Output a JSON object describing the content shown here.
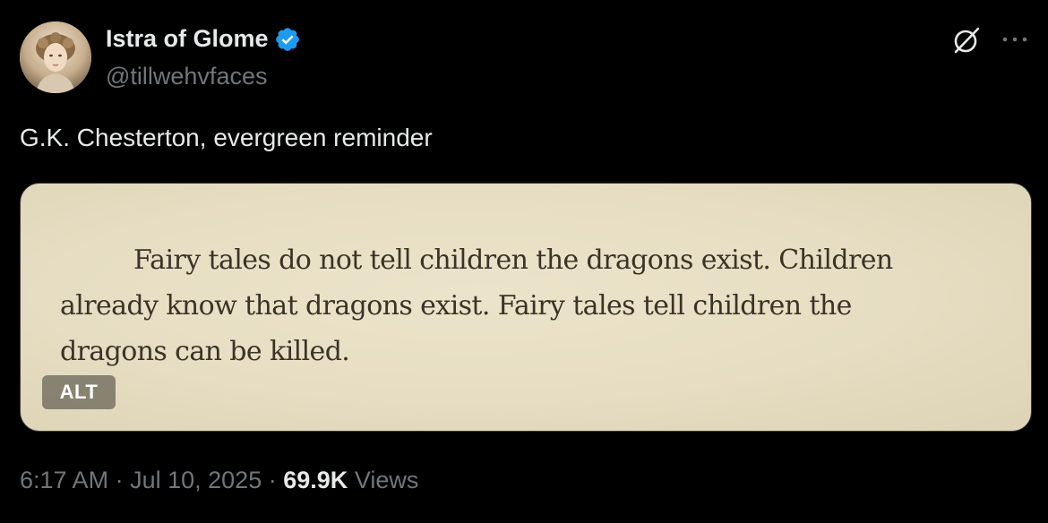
{
  "author": {
    "display_name": "Istra of Glome",
    "handle": "@tillwehvfaces",
    "verified": true,
    "verified_color": "#1d9bf0"
  },
  "header_actions": {
    "grok_icon": "grok-icon",
    "more_icon": "more-icon"
  },
  "tweet": {
    "text": "G.K. Chesterton, evergreen reminder"
  },
  "media": {
    "quote": "Fairy tales do not tell children the dragons exist. Children already know that dragons exist. Fairy tales tell children the dragons can be killed.",
    "alt_label": "ALT"
  },
  "meta": {
    "time": "6:17 AM",
    "separator": "·",
    "date": "Jul 10, 2025",
    "views_count": "69.9K",
    "views_label": "Views"
  },
  "colors": {
    "background": "#000000",
    "primary_text": "#e7e9ea",
    "secondary_text": "#71767b",
    "parchment": "#e8e0c6"
  }
}
